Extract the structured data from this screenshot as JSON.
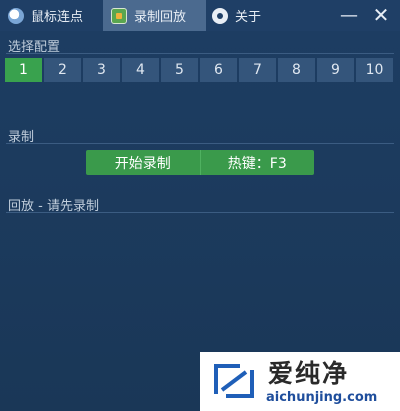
{
  "tabs": [
    {
      "label": "鼠标连点",
      "icon": "mouse-icon",
      "active": false
    },
    {
      "label": "录制回放",
      "icon": "record-icon",
      "active": true
    },
    {
      "label": "关于",
      "icon": "chat-icon",
      "active": false
    }
  ],
  "window": {
    "minimize": "—",
    "close": "✕"
  },
  "config": {
    "label": "选择配置",
    "options": [
      "1",
      "2",
      "3",
      "4",
      "5",
      "6",
      "7",
      "8",
      "9",
      "10"
    ],
    "selected": "1"
  },
  "record": {
    "label": "录制",
    "start_button": "开始录制",
    "hotkey": "热键：F3"
  },
  "playback": {
    "label": "回放 - 请先录制"
  },
  "watermark": {
    "title": "爱纯净",
    "url": "aichunjing.com"
  },
  "colors": {
    "accent_green": "#3a9a4b",
    "background": "#1d3d62",
    "tab_active": "#4b6a8f"
  }
}
